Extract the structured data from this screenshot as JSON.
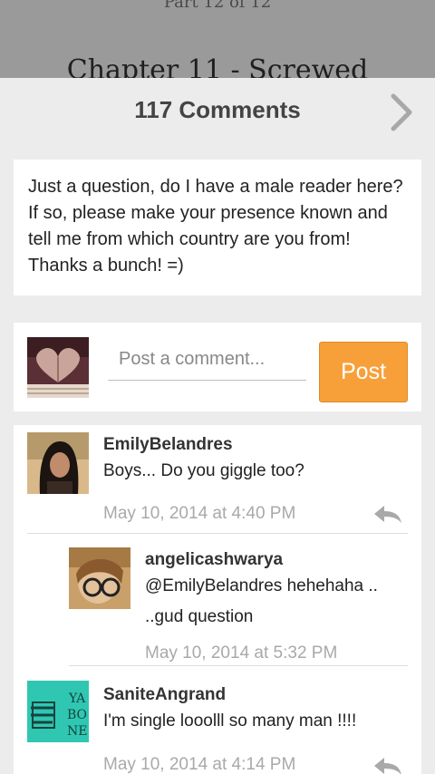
{
  "reader": {
    "part": "Part 12 of 12",
    "chapter_title": "Chapter 11 - Screwed"
  },
  "header": {
    "title": "117 Comments"
  },
  "author_note": "Just a question, do I have a male reader here? If so, please make your presence known and tell me from which country are you from! Thanks a bunch! =)",
  "compose": {
    "placeholder": "Post a comment...",
    "post_label": "Post"
  },
  "comments": [
    {
      "user": "EmilyBelandres",
      "text": "Boys... Do you giggle too?",
      "time": "May 10, 2014 at 4:40 PM"
    },
    {
      "user": "angelicashwarya",
      "text_line1": "@EmilyBelandres   hehehaha ..",
      "text_line2": "..gud question",
      "time": "May 10, 2014 at 5:32 PM"
    },
    {
      "user": "SaniteAngrand",
      "text": "I'm single looolll so many man !!!!",
      "time": "May 10, 2014 at 4:14 PM"
    }
  ],
  "colors": {
    "accent": "#f7a03a",
    "timestamp": "#a9a9a9"
  }
}
